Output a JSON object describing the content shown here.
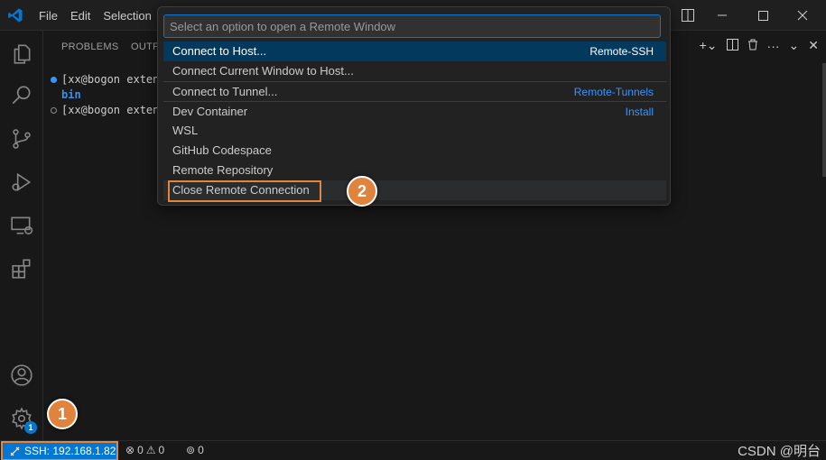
{
  "menu": {
    "file": "File",
    "edit": "Edit",
    "selection": "Selection"
  },
  "panel": {
    "tabs": [
      "PROBLEMS",
      "OUTP"
    ],
    "terminal_lines": [
      "[xx@bogon exten",
      "bin",
      "[xx@bogon exten"
    ]
  },
  "quickpick": {
    "placeholder": "Select an option to open a Remote Window",
    "items": [
      {
        "label": "Connect to Host...",
        "detail": "Remote-SSH"
      },
      {
        "label": "Connect Current Window to Host...",
        "detail": ""
      },
      {
        "label": "Connect to Tunnel...",
        "detail": "Remote-Tunnels"
      },
      {
        "label": "Dev Container",
        "detail": "Install"
      },
      {
        "label": "WSL",
        "detail": ""
      },
      {
        "label": "GitHub Codespace",
        "detail": ""
      },
      {
        "label": "Remote Repository",
        "detail": ""
      },
      {
        "label": "Close Remote Connection",
        "detail": ""
      }
    ]
  },
  "callouts": {
    "one": "1",
    "two": "2"
  },
  "activity": {
    "settings_badge": "1"
  },
  "statusbar": {
    "remote": "SSH: 192.168.1.82",
    "errors": "0",
    "warnings": "0",
    "ports": "0"
  },
  "watermark": "CSDN @明台",
  "colors": {
    "accent": "#0078d4",
    "callout": "#e0843d",
    "highlight": "#e8833a",
    "selection": "#04395e"
  }
}
